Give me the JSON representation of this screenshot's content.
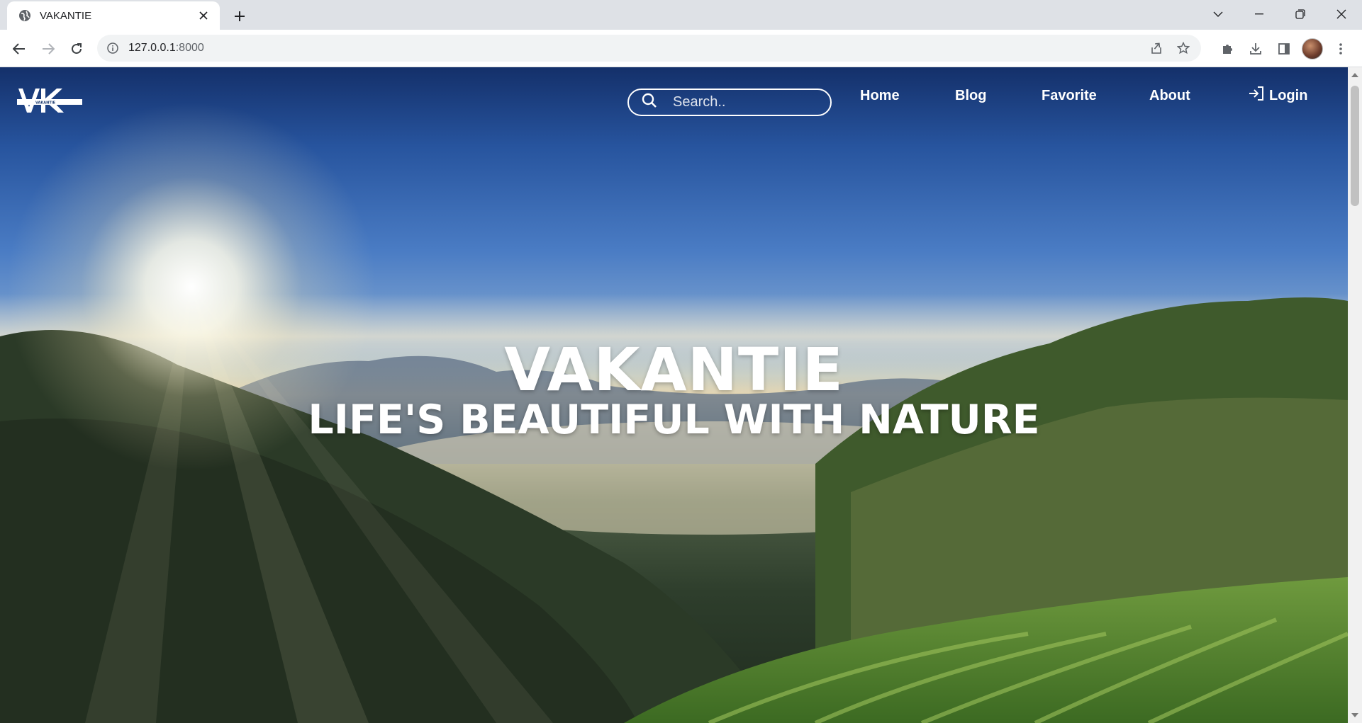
{
  "browser": {
    "tab_title": "VAKANTIE",
    "url_host": "127.0.0.1",
    "url_port": ":8000"
  },
  "site": {
    "logo_text": "VK",
    "logo_subtext": "VAKANTIE",
    "search_placeholder": "Search..",
    "nav": {
      "home": "Home",
      "blog": "Blog",
      "favorite": "Favorite",
      "about": "About",
      "login": "Login"
    }
  },
  "hero": {
    "title": "VAKANTIE",
    "subtitle": "LIFE'S BEAUTIFUL WITH NATURE"
  },
  "colors": {
    "nav_text": "#ffffff",
    "sky_top": "#14306a",
    "foliage": "#2e3e2c"
  }
}
